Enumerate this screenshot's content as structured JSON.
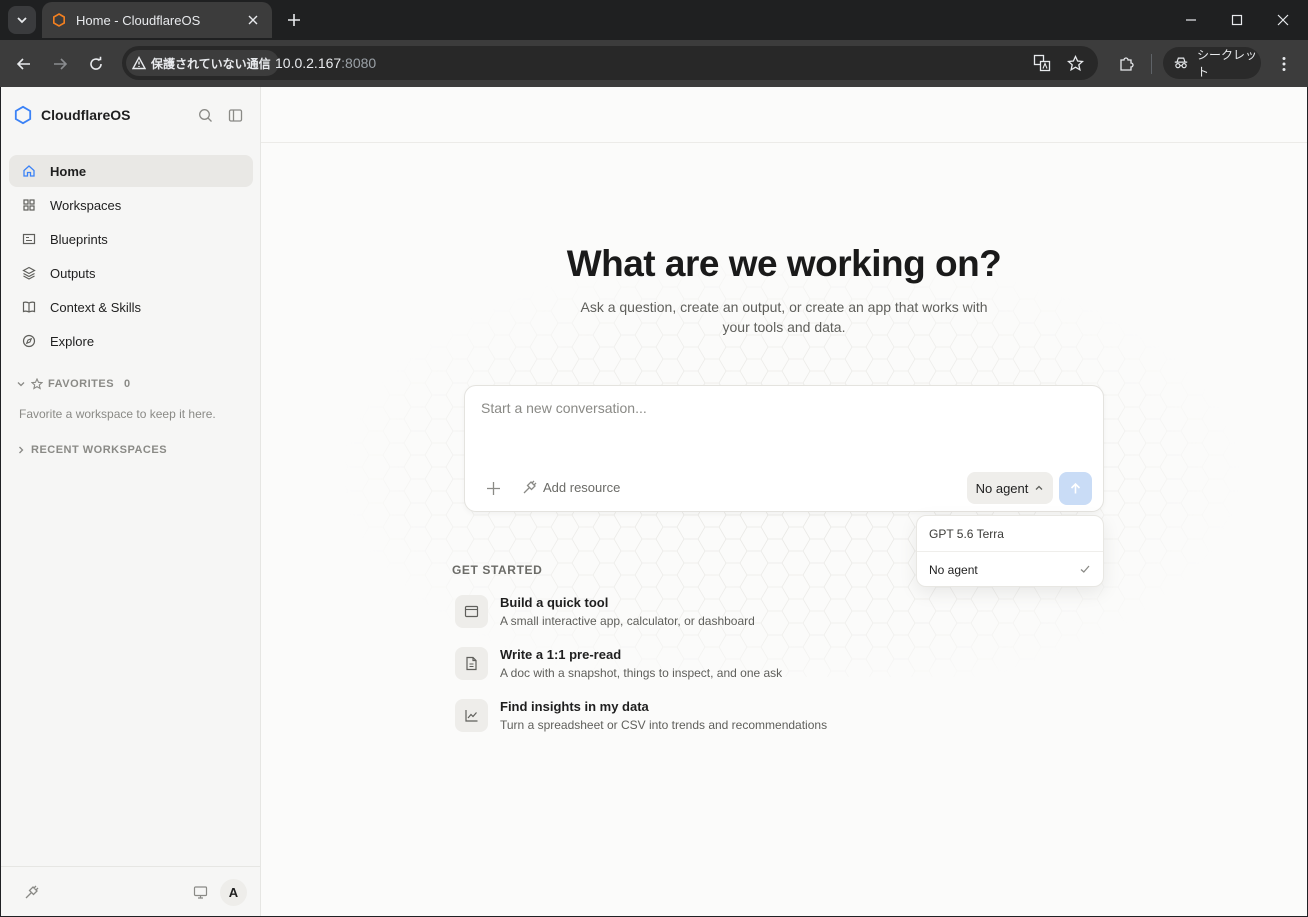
{
  "browser": {
    "tab_title": "Home - CloudflareOS",
    "security_label": "保護されていない通信",
    "url_host": "10.0.2.167",
    "url_port": ":8080",
    "incognito_label": "シークレット"
  },
  "sidebar": {
    "brand": "CloudflareOS",
    "nav_items": [
      {
        "label": "Home",
        "icon": "home-icon",
        "active": true
      },
      {
        "label": "Workspaces",
        "icon": "grid-icon"
      },
      {
        "label": "Blueprints",
        "icon": "blueprint-icon"
      },
      {
        "label": "Outputs",
        "icon": "layers-icon"
      },
      {
        "label": "Context & Skills",
        "icon": "book-icon"
      },
      {
        "label": "Explore",
        "icon": "compass-icon"
      }
    ],
    "favorites": {
      "label": "FAVORITES",
      "count": "0",
      "hint": "Favorite a workspace to keep it here."
    },
    "recent": {
      "label": "RECENT WORKSPACES"
    },
    "avatar_initial": "A"
  },
  "main": {
    "title": "What are we working on?",
    "subtitle": "Ask a question, create an output, or create an app that works with your tools and data.",
    "composer": {
      "placeholder": "Start a new conversation...",
      "add_resource": "Add resource",
      "agent_label": "No agent"
    },
    "agent_dropdown": {
      "options": [
        {
          "label": "GPT 5.6 Terra",
          "selected": false
        },
        {
          "label": "No agent",
          "selected": true
        }
      ]
    },
    "get_started": {
      "title": "GET STARTED",
      "items": [
        {
          "title": "Build a quick tool",
          "desc": "A small interactive app, calculator, or dashboard",
          "icon": "window-icon"
        },
        {
          "title": "Write a 1:1 pre-read",
          "desc": "A doc with a snapshot, things to inspect, and one ask",
          "icon": "document-icon"
        },
        {
          "title": "Find insights in my data",
          "desc": "Turn a spreadsheet or CSV into trends and recommendations",
          "icon": "chart-icon"
        }
      ]
    }
  },
  "colors": {
    "accent": "#3b82f6",
    "send_button": "#c9dcf6",
    "tab_favicon": "#f38020"
  }
}
